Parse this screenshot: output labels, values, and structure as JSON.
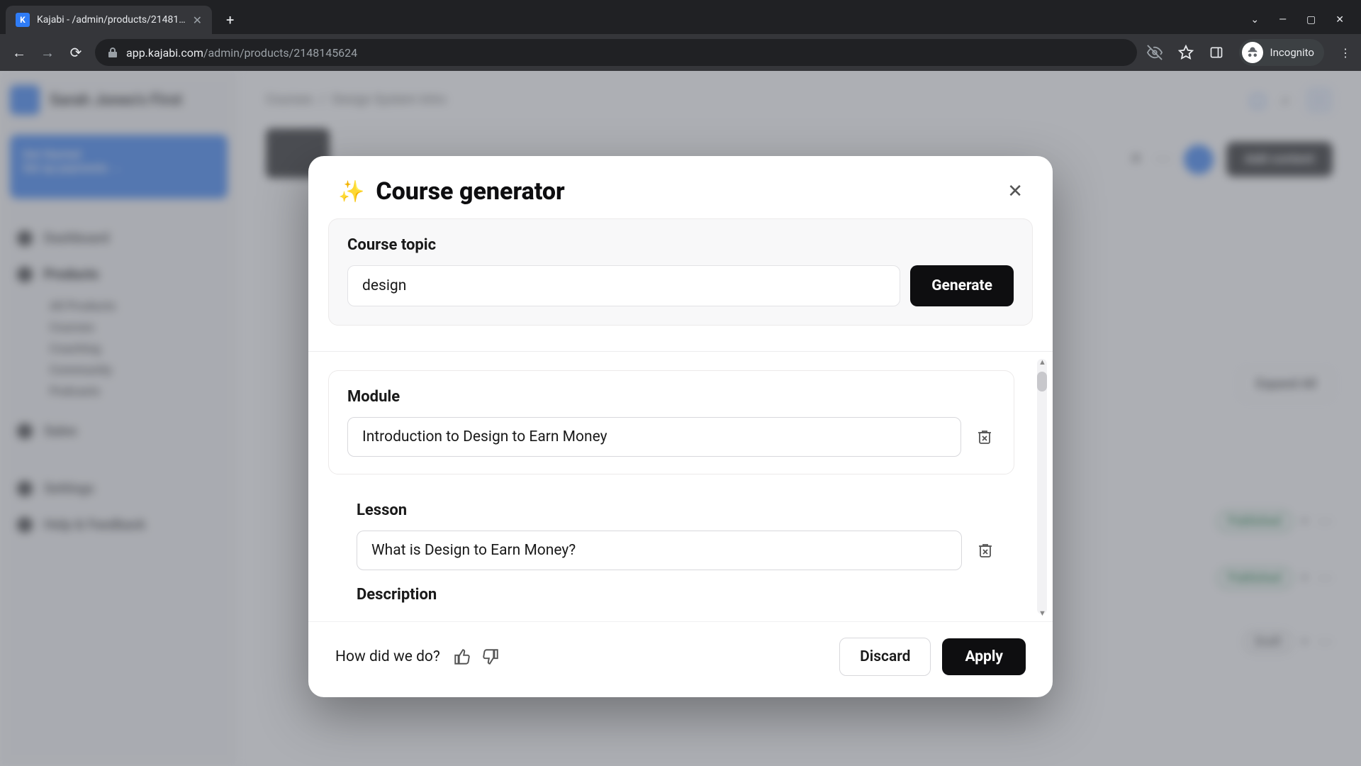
{
  "browser": {
    "tab_title": "Kajabi - /admin/products/21481…",
    "url_domain": "app.kajabi.com",
    "url_path": "/admin/products/2148145624",
    "incognito_label": "Incognito"
  },
  "background": {
    "workspace_name": "Sarah Jones's First",
    "banner_line1": "Get Started",
    "banner_line2": "Set up payments →",
    "nav": {
      "dashboard": "Dashboard",
      "products": "Products",
      "all_products": "All Products",
      "courses": "Courses",
      "coaching": "Coaching",
      "community": "Community",
      "podcasts": "Podcasts",
      "sales": "Sales",
      "settings": "Settings",
      "help": "Help & Feedback"
    },
    "breadcrumb1": "Courses",
    "breadcrumb2": "Design System Intro",
    "add_content": "Add content",
    "expand_all": "Expand All",
    "status_published": "Published",
    "status_draft": "Draft"
  },
  "modal": {
    "title": "Course generator",
    "topic_label": "Course topic",
    "topic_value": "design",
    "generate_label": "Generate",
    "module_label": "Module",
    "module_value": "Introduction to Design to Earn Money",
    "lesson_label": "Lesson",
    "lesson_value": "What is Design to Earn Money?",
    "description_label": "Description",
    "feedback_label": "How did we do?",
    "discard_label": "Discard",
    "apply_label": "Apply"
  }
}
